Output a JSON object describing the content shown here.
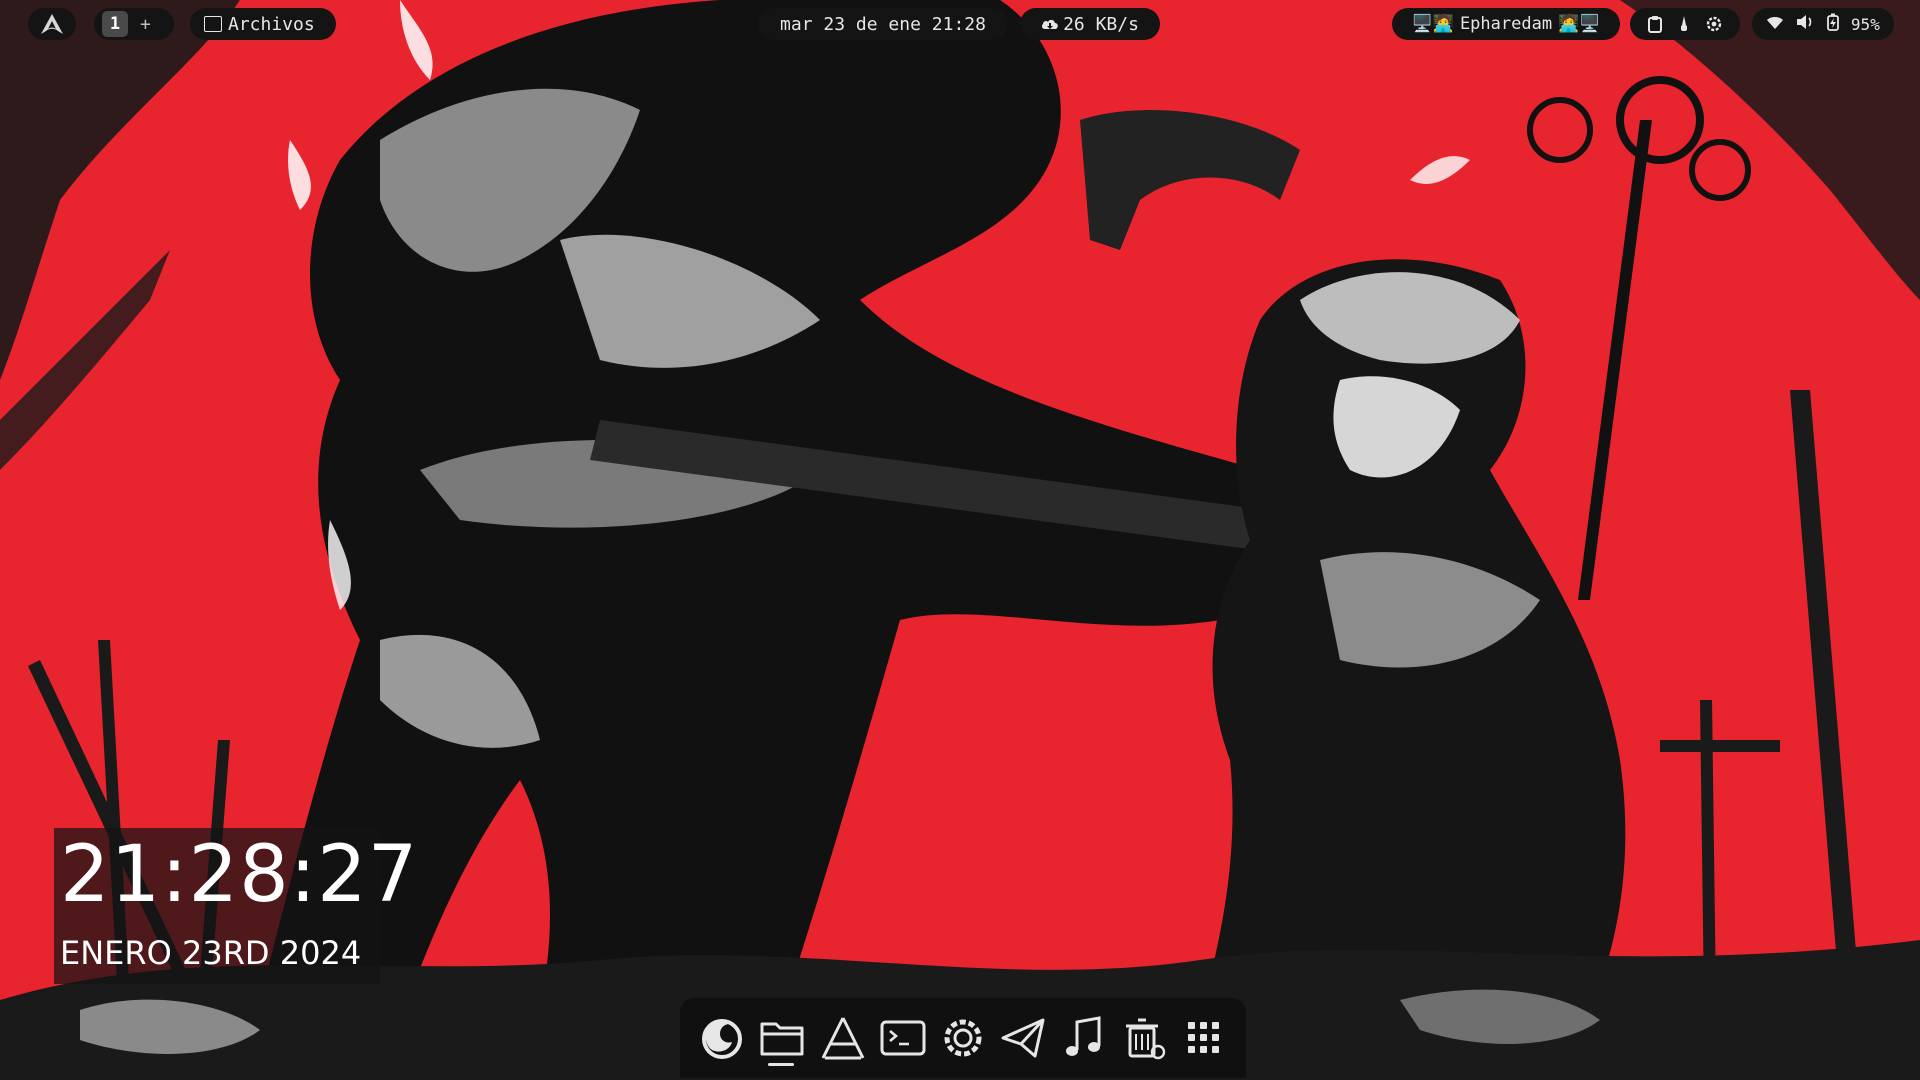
{
  "desktop": {
    "wallpaper": "goblin-slayer-red-manga-art",
    "accent": "#e8242f"
  },
  "topbar": {
    "launcher_icon": "arch-linux-icon",
    "workspaces": {
      "active": "1",
      "add": "+"
    },
    "files": {
      "icon": "folder-icon",
      "label": "Archivos"
    },
    "datetime": "mar 23 de ene 21:28",
    "network": {
      "icon": "download-cloud-icon",
      "speed": "26 KB/s"
    },
    "user": {
      "left_icons": "🖥️🧑‍💻",
      "name": "Epharedam",
      "right_icons": "🧑‍💻🖥️"
    },
    "tray": [
      "clipboard-icon",
      "brush-icon",
      "gear-icon"
    ],
    "system": {
      "wifi": "wifi-icon",
      "volume": "volume-icon",
      "battery_icon": "battery-icon",
      "battery": "95%"
    }
  },
  "clock_widget": {
    "time": "21:28:27",
    "date": "ENERO 23RD 2024"
  },
  "dock": {
    "items": [
      "firefox-icon",
      "folder-icon",
      "arch-linux-icon",
      "terminal-icon",
      "settings-icon",
      "telegram-icon",
      "music-icon",
      "trash-icon",
      "app-grid-icon"
    ]
  }
}
